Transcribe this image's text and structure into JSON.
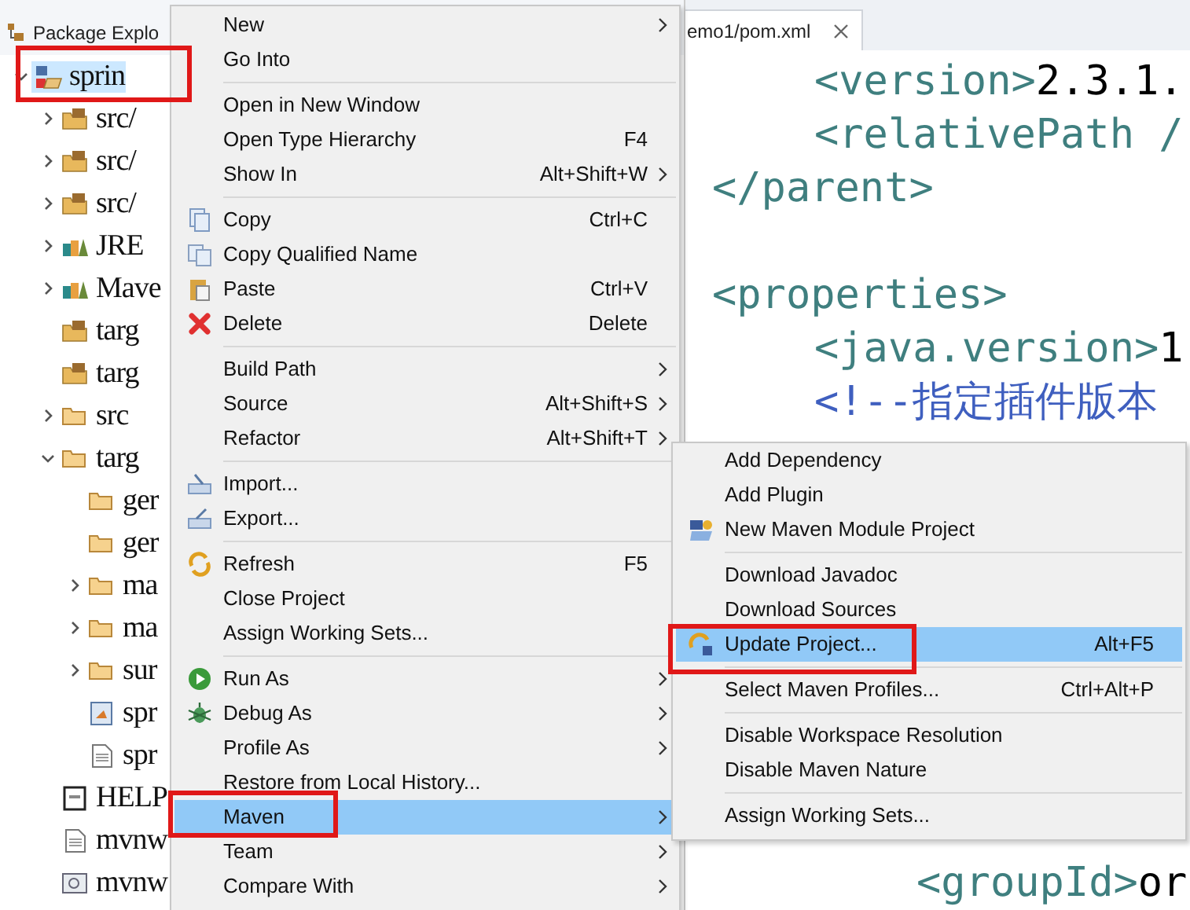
{
  "explorer": {
    "title": "Package Explo",
    "tree": [
      {
        "label": "sprin",
        "kind": "project",
        "selected": true,
        "expanded": true,
        "children": [
          {
            "label": "src/",
            "kind": "source-folder",
            "selected": false,
            "expanded": false
          },
          {
            "label": "src/",
            "kind": "source-folder",
            "selected": false,
            "expanded": false
          },
          {
            "label": "src/",
            "kind": "source-folder",
            "selected": false,
            "expanded": false
          },
          {
            "label": "JRE",
            "kind": "library",
            "selected": false,
            "expanded": false
          },
          {
            "label": "Mave",
            "kind": "library",
            "selected": false,
            "expanded": false
          },
          {
            "label": "targ",
            "kind": "source-folder",
            "selected": false
          },
          {
            "label": "targ",
            "kind": "source-folder",
            "selected": false
          },
          {
            "label": "src",
            "kind": "folder",
            "selected": false,
            "expanded": false
          },
          {
            "label": "targ",
            "kind": "folder",
            "selected": false,
            "expanded": true,
            "children": [
              {
                "label": "ger",
                "kind": "folder",
                "selected": false
              },
              {
                "label": "ger",
                "kind": "folder",
                "selected": false
              },
              {
                "label": "ma",
                "kind": "folder",
                "selected": false,
                "expanded": false
              },
              {
                "label": "ma",
                "kind": "folder",
                "selected": false,
                "expanded": false
              },
              {
                "label": "sur",
                "kind": "folder",
                "selected": false,
                "expanded": false
              },
              {
                "label": "spr",
                "kind": "archive",
                "selected": false
              },
              {
                "label": "spr",
                "kind": "file",
                "selected": false
              }
            ]
          },
          {
            "label": "HELP",
            "kind": "doc",
            "selected": false
          },
          {
            "label": "mvnw",
            "kind": "file",
            "selected": false
          },
          {
            "label": "mvnw",
            "kind": "script",
            "selected": false
          }
        ]
      }
    ]
  },
  "editor": {
    "tab": "emo1/pom.xml",
    "lines": [
      {
        "kind": "group",
        "children": [
          {
            "kind": "line",
            "segments": [
              {
                "kind": "tag",
                "text": "<version>"
              },
              {
                "kind": "text",
                "text": "2.3.1."
              }
            ]
          },
          {
            "kind": "line",
            "segments": [
              {
                "kind": "tag",
                "text": "<relativePath /"
              }
            ]
          }
        ]
      },
      {
        "kind": "line",
        "segments": [
          {
            "kind": "tag",
            "text": "</parent>"
          }
        ]
      },
      {
        "kind": "blank"
      },
      {
        "kind": "line",
        "segments": [
          {
            "kind": "tag",
            "text": "<properties>"
          }
        ],
        "children": [
          {
            "kind": "line",
            "segments": [
              {
                "kind": "tag",
                "text": "<java.version>"
              },
              {
                "kind": "text",
                "text": "1"
              }
            ]
          },
          {
            "kind": "line",
            "segments": [
              {
                "kind": "comment",
                "text": "<!--指定插件版本"
              }
            ]
          }
        ]
      }
    ],
    "bottom_lines": [
      {
        "kind": "group",
        "children": [
          {
            "kind": "group",
            "children": [
              {
                "kind": "line",
                "segments": [
                  {
                    "kind": "tag",
                    "text": "<groupId>"
                  },
                  {
                    "kind": "text",
                    "text": "or"
                  }
                ]
              }
            ]
          }
        ]
      }
    ]
  },
  "context_menu": {
    "items": [
      {
        "kind": "item",
        "label": "New",
        "selected": false,
        "submenu": true
      },
      {
        "kind": "item",
        "label": "Go Into",
        "selected": false,
        "submenu": false
      },
      {
        "kind": "separator"
      },
      {
        "kind": "item",
        "label": "Open in New Window",
        "selected": false,
        "submenu": false
      },
      {
        "kind": "item",
        "label": "Open Type Hierarchy",
        "shortcut": "F4",
        "selected": false,
        "submenu": false
      },
      {
        "kind": "item",
        "label": "Show In",
        "shortcut": "Alt+Shift+W",
        "selected": false,
        "submenu": true
      },
      {
        "kind": "separator"
      },
      {
        "kind": "item",
        "label": "Copy",
        "shortcut": "Ctrl+C",
        "selected": false,
        "submenu": false
      },
      {
        "kind": "item",
        "label": "Copy Qualified Name",
        "selected": false,
        "submenu": false
      },
      {
        "kind": "item",
        "label": "Paste",
        "shortcut": "Ctrl+V",
        "selected": false,
        "submenu": false
      },
      {
        "kind": "item",
        "label": "Delete",
        "shortcut": "Delete",
        "selected": false,
        "submenu": false
      },
      {
        "kind": "separator"
      },
      {
        "kind": "item",
        "label": "Build Path",
        "selected": false,
        "submenu": true
      },
      {
        "kind": "item",
        "label": "Source",
        "shortcut": "Alt+Shift+S",
        "selected": false,
        "submenu": true
      },
      {
        "kind": "item",
        "label": "Refactor",
        "shortcut": "Alt+Shift+T",
        "selected": false,
        "submenu": true
      },
      {
        "kind": "separator"
      },
      {
        "kind": "item",
        "label": "Import...",
        "selected": false,
        "submenu": false
      },
      {
        "kind": "item",
        "label": "Export...",
        "selected": false,
        "submenu": false
      },
      {
        "kind": "separator"
      },
      {
        "kind": "item",
        "label": "Refresh",
        "shortcut": "F5",
        "selected": false,
        "submenu": false
      },
      {
        "kind": "item",
        "label": "Close Project",
        "selected": false,
        "submenu": false
      },
      {
        "kind": "item",
        "label": "Assign Working Sets...",
        "selected": false,
        "submenu": false
      },
      {
        "kind": "separator"
      },
      {
        "kind": "item",
        "label": "Run As",
        "selected": false,
        "submenu": true
      },
      {
        "kind": "item",
        "label": "Debug As",
        "selected": false,
        "submenu": true
      },
      {
        "kind": "item",
        "label": "Profile As",
        "selected": false,
        "submenu": true
      },
      {
        "kind": "item",
        "label": "Restore from Local History...",
        "selected": false,
        "submenu": false
      },
      {
        "kind": "item",
        "label": "Maven",
        "selected": true,
        "submenu": true
      },
      {
        "kind": "item",
        "label": "Team",
        "selected": false,
        "submenu": true
      },
      {
        "kind": "item",
        "label": "Compare With",
        "selected": false,
        "submenu": true
      }
    ]
  },
  "maven_submenu": {
    "items": [
      {
        "kind": "item",
        "label": "Add Dependency",
        "selected": false,
        "submenu": false
      },
      {
        "kind": "item",
        "label": "Add Plugin",
        "selected": false,
        "submenu": false
      },
      {
        "kind": "item",
        "label": "New Maven Module Project",
        "selected": false,
        "submenu": false
      },
      {
        "kind": "separator"
      },
      {
        "kind": "item",
        "label": "Download Javadoc",
        "selected": false,
        "submenu": false
      },
      {
        "kind": "item",
        "label": "Download Sources",
        "selected": false,
        "submenu": false
      },
      {
        "kind": "item",
        "label": "Update Project...",
        "shortcut": "Alt+F5",
        "selected": true,
        "submenu": false
      },
      {
        "kind": "separator"
      },
      {
        "kind": "item",
        "label": "Select Maven Profiles...",
        "shortcut": "Ctrl+Alt+P",
        "selected": false,
        "submenu": false
      },
      {
        "kind": "separator"
      },
      {
        "kind": "item",
        "label": "Disable Workspace Resolution",
        "selected": false,
        "submenu": false
      },
      {
        "kind": "item",
        "label": "Disable Maven Nature",
        "selected": false,
        "submenu": false
      },
      {
        "kind": "separator"
      },
      {
        "kind": "item",
        "label": "Assign Working Sets...",
        "selected": false,
        "submenu": false
      }
    ]
  }
}
